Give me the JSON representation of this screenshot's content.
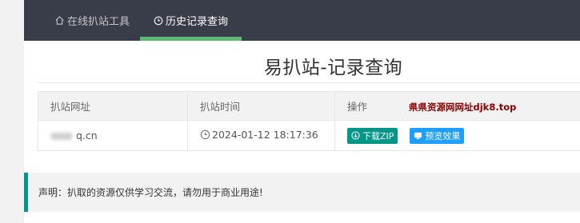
{
  "nav": {
    "items": [
      {
        "label": "在线扒站工具",
        "icon": "home-icon"
      },
      {
        "label": "历史记录查询",
        "icon": "clock-icon"
      }
    ],
    "active_index": 1,
    "colors": {
      "background": "#393d49",
      "active_underline": "#5fb878"
    }
  },
  "page": {
    "title": "易扒站-记录查询"
  },
  "table": {
    "headers": [
      "扒站网址",
      "扒站时间",
      "操作"
    ],
    "watermark": "県県资源网网址djk8.top",
    "rows": [
      {
        "url": "q.cn",
        "time": "2024-01-12 18:17:36",
        "download_label": "下载ZIP",
        "preview_label": "预览效果"
      }
    ]
  },
  "notice": {
    "text": "声明：扒取的资源仅供学习交流，请勿用于商业用途!"
  },
  "colors": {
    "download_button": "#009688",
    "preview_button": "#1e9fff",
    "watermark": "#8b0000"
  }
}
